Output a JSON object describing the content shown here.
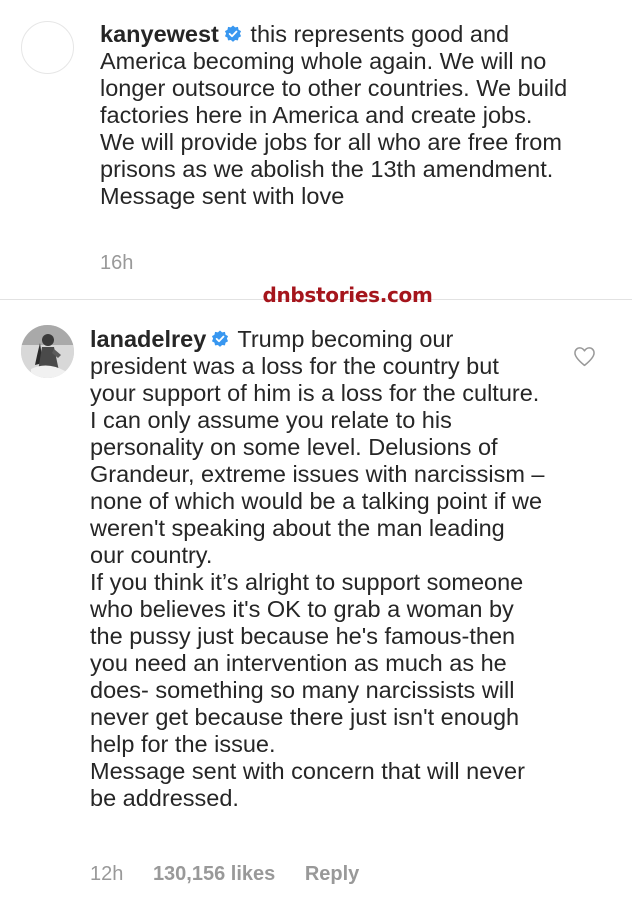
{
  "comments": [
    {
      "username": "kanyewest",
      "verified": true,
      "text_lines": [
        "this represents good and America becoming whole again.  We will no longer outsource to other countries. We build factories here in America and create jobs.  We will provide jobs for all who are free from prisons as we abolish the 13th amendment. Message sent with love"
      ],
      "time": "16h"
    },
    {
      "username": "lanadelrey",
      "verified": true,
      "paragraphs": [
        "Trump becoming our president was a loss for the country but your support of him is a loss for the culture.",
        "I can only assume you relate to his personality on some level. Delusions of Grandeur, extreme issues with narcissism – none of which would be a talking point if we weren't speaking about the man leading our country.",
        "If you think it’s alright to support someone who believes it's OK to grab a woman by the pussy just because he's famous-then you need an intervention as much as he does- something so many narcissists will never get because there just isn't enough help for the issue.",
        "Message sent with concern that will never be addressed."
      ],
      "time": "12h",
      "likes": "130,156 likes",
      "reply_label": "Reply"
    }
  ],
  "watermark": "dnbstories.com",
  "icons": {
    "verified": "verified-badge-icon",
    "heart": "heart-outline-icon"
  },
  "colors": {
    "text": "#262626",
    "meta": "#999999",
    "verified_blue": "#3897f0",
    "watermark": "#a5151c",
    "divider": "#e2e2e2"
  }
}
